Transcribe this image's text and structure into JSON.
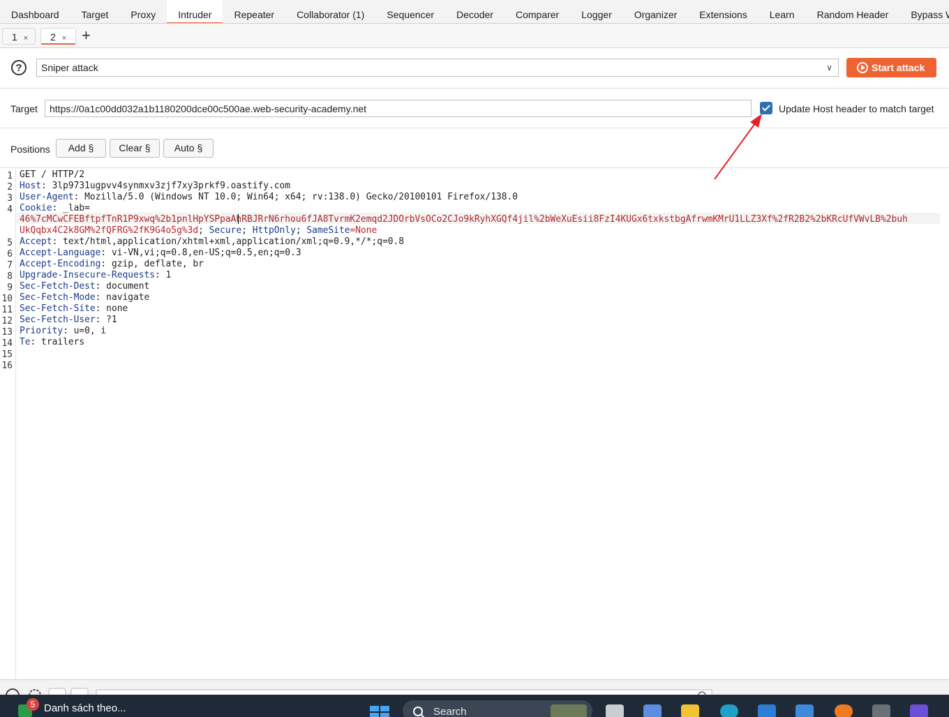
{
  "tool_tabs": [
    "Dashboard",
    "Target",
    "Proxy",
    "Intruder",
    "Repeater",
    "Collaborator (1)",
    "Sequencer",
    "Decoder",
    "Comparer",
    "Logger",
    "Organizer",
    "Extensions",
    "Learn",
    "Random Header",
    "Bypass WAF"
  ],
  "active_tool_tab": "Intruder",
  "sub_tabs": [
    {
      "label": "1",
      "close": "×"
    },
    {
      "label": "2",
      "close": "×"
    }
  ],
  "add_tab": "+",
  "help_icon": "?",
  "attack_type": "Sniper attack",
  "start_attack_label": "Start attack",
  "target_label": "Target",
  "target_url": "https://0a1c00dd032a1b1180200dce00c500ae.web-security-academy.net",
  "update_host_label": "Update Host header to match target",
  "update_host_checked": true,
  "positions_label": "Positions",
  "buttons": {
    "add": "Add §",
    "clear": "Clear §",
    "auto": "Auto §"
  },
  "line_numbers": [
    "1",
    "2",
    "3",
    "4",
    "",
    "",
    "5",
    "6",
    "7",
    "8",
    "9",
    "10",
    "11",
    "12",
    "13",
    "14",
    "15",
    "16"
  ],
  "request": {
    "l1": "GET / HTTP/2",
    "host_name": "Host",
    "host_val": " 3lp9731ugpvv4synmxv3zjf7xy3prkf9.oastify.com",
    "ua_name": "User-Agent",
    "ua_val": " Mozilla/5.0 (Windows NT 10.0; Win64; x64; rv:138.0) Gecko/20100101 Firefox/138.0",
    "cookie_name": "Cookie",
    "cookie_key": " _lab=",
    "cookie_v1": "46%7cMCwCFEBftpfTnR1P9xwq%2b1pnlHpYSPpaAhRBJRrN6rhou6fJA8TvrmK2emqd2JDOrbVsOCo2CJo9kRyhXGQf4jil%2bWeXuEsii8FzI4KUGx6txkstbgAfrwmKMrU1LLZ3Xf%2fR2B2%2bKRcUfVWvLB%2buh",
    "cookie_v2": "UkQqbx4C2k8GM%2fQFRG%2fK9G4o5g%3d",
    "cookie_sep1": "; ",
    "secure": "Secure",
    "cookie_sep2": "; ",
    "httponly": "HttpOnly",
    "cookie_sep3": "; ",
    "samesite": "SameSite",
    "samesite_val": "=None",
    "accept_name": "Accept",
    "accept_val": " text/html,application/xhtml+xml,application/xml;q=0.9,*/*;q=0.8",
    "lang_name": "Accept-Language",
    "lang_val": " vi-VN,vi;q=0.8,en-US;q=0.5,en;q=0.3",
    "enc_name": "Accept-Encoding",
    "enc_val": " gzip, deflate, br",
    "uir_name": "Upgrade-Insecure-Requests",
    "uir_val": " 1",
    "dest_name": "Sec-Fetch-Dest",
    "dest_val": " document",
    "mode_name": "Sec-Fetch-Mode",
    "mode_val": " navigate",
    "site_name": "Sec-Fetch-Site",
    "site_val": " none",
    "user_name": "Sec-Fetch-User",
    "user_val": " ?1",
    "prio_name": "Priority",
    "prio_val": " u=0, i",
    "te_name": "Te",
    "te_val": " trailers"
  },
  "taskbar": {
    "badge": "5",
    "window_title": "Danh sách theo...",
    "search_placeholder": "Search"
  },
  "colors": {
    "accent": "#ef6333",
    "checkbox": "#2f6fb3",
    "header_name": "#1a3a8a",
    "cookie_value": "#b5262a",
    "annotation_arrow": "#e8202a"
  }
}
